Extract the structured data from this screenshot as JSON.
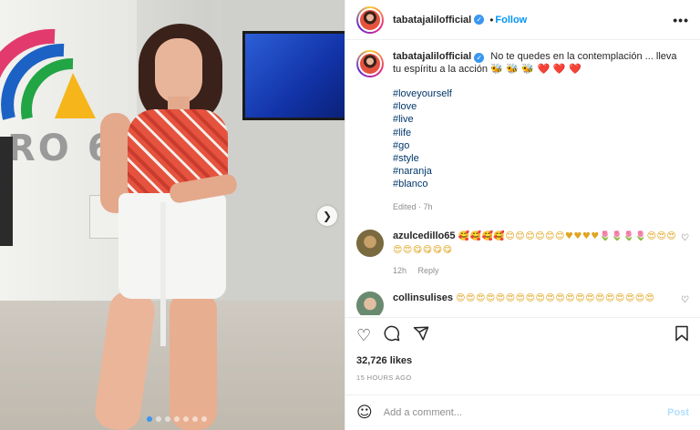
{
  "post": {
    "image": {
      "carousel_dots": 7,
      "active_dot": 0,
      "next_icon": "chevron-right-icon",
      "background_text": "RO 6"
    },
    "header": {
      "username": "tabatajalilofficial",
      "verified_icon": "verified-icon",
      "separator": "•",
      "follow_label": "Follow",
      "more_icon": "more-options-icon",
      "more_glyph": "•••"
    },
    "caption": {
      "username": "tabatajalilofficial",
      "text": "No te quedes en la contemplación ... lleva tu espíritu a la acción",
      "emojis": "🐝 🐝 🐝 ❤️ ❤️ ❤️",
      "hashtags": [
        "#loveyourself",
        "#love",
        "#live",
        "#life",
        "#go",
        "#style",
        "#naranja",
        "#blanco"
      ],
      "meta": "Edited · 7h"
    },
    "comments": [
      {
        "username": "azulcedillo65",
        "text": "🥰🥰🥰🥰😊😊😊😊😊😊♥♥♥♥🌷🌷🌷🌷😍😍😍😍😍😋😋😋😋",
        "time": "12h",
        "reply_label": "Reply"
      },
      {
        "username": "collinsulises",
        "text": "😍😍😍😍😍😍😍😍😍😍😍😍😍😍😍😍😍😍😍😍",
        "time": "",
        "reply_label": ""
      }
    ],
    "actions": {
      "like_icon": "heart-icon",
      "comment_icon": "comment-icon",
      "share_icon": "share-icon",
      "save_icon": "bookmark-icon"
    },
    "likes": "32,726 likes",
    "posted_ago": "15 HOURS AGO",
    "add_comment": {
      "placeholder": "Add a comment...",
      "emoji_icon": "smiley-icon",
      "post_label": "Post"
    }
  }
}
